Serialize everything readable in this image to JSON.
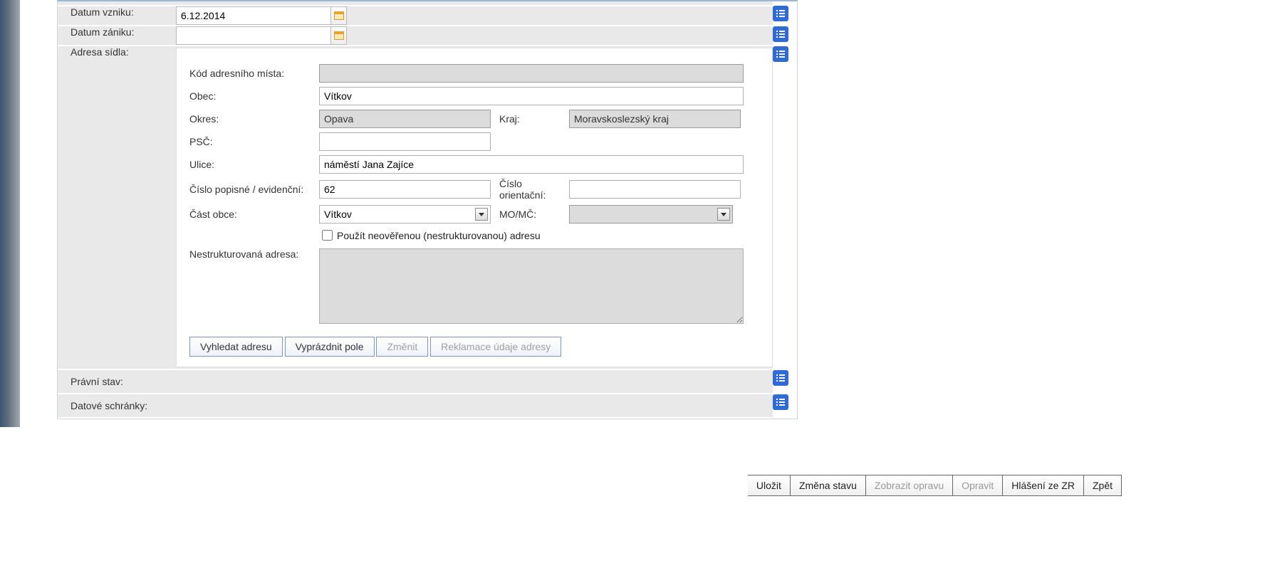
{
  "rows": {
    "datum_vzniku_label": "Datum vzniku:",
    "datum_vzniku_value": "6.12.2014",
    "datum_zaniku_label": "Datum zániku:",
    "datum_zaniku_value": "",
    "adresa_sidla_label": "Adresa sídla:",
    "pravni_stav_label": "Právní stav:",
    "pravni_stav_value": "",
    "datove_schranky_label": "Datové schránky:",
    "datove_schranky_value": ""
  },
  "addr": {
    "kod_label": "Kód adresního místa:",
    "kod_value": "",
    "obec_label": "Obec:",
    "obec_value": "Vítkov",
    "okres_label": "Okres:",
    "okres_value": "Opava",
    "kraj_label": "Kraj:",
    "kraj_value": "Moravskoslezský kraj",
    "psc_label": "PSČ:",
    "psc_value": "",
    "ulice_label": "Ulice:",
    "ulice_value": "náměstí Jana Zajíce",
    "cp_label": "Číslo popisné / evidenční:",
    "cp_value": "62",
    "co_label": "Číslo orientační:",
    "co_value": "",
    "cast_label": "Část obce:",
    "cast_value": "Vítkov",
    "momc_label": "MO/MČ:",
    "momc_value": "",
    "chk_label": "Použít neověřenou (nestrukturovanou) adresu",
    "unstruct_label": "Nestrukturovaná adresa:",
    "unstruct_value": "",
    "btn_vyhledat": "Vyhledat adresu",
    "btn_vyprazdnit": "Vyprázdnit pole",
    "btn_zmenit": "Změnit",
    "btn_reklamace": "Reklamace údaje adresy"
  },
  "footer": {
    "ulozit": "Uložit",
    "zmena_stavu": "Změna stavu",
    "zobrazit_opravu": "Zobrazit opravu",
    "opravit": "Opravit",
    "hlaseni": "Hlášení ze ZR",
    "zpet": "Zpět"
  }
}
